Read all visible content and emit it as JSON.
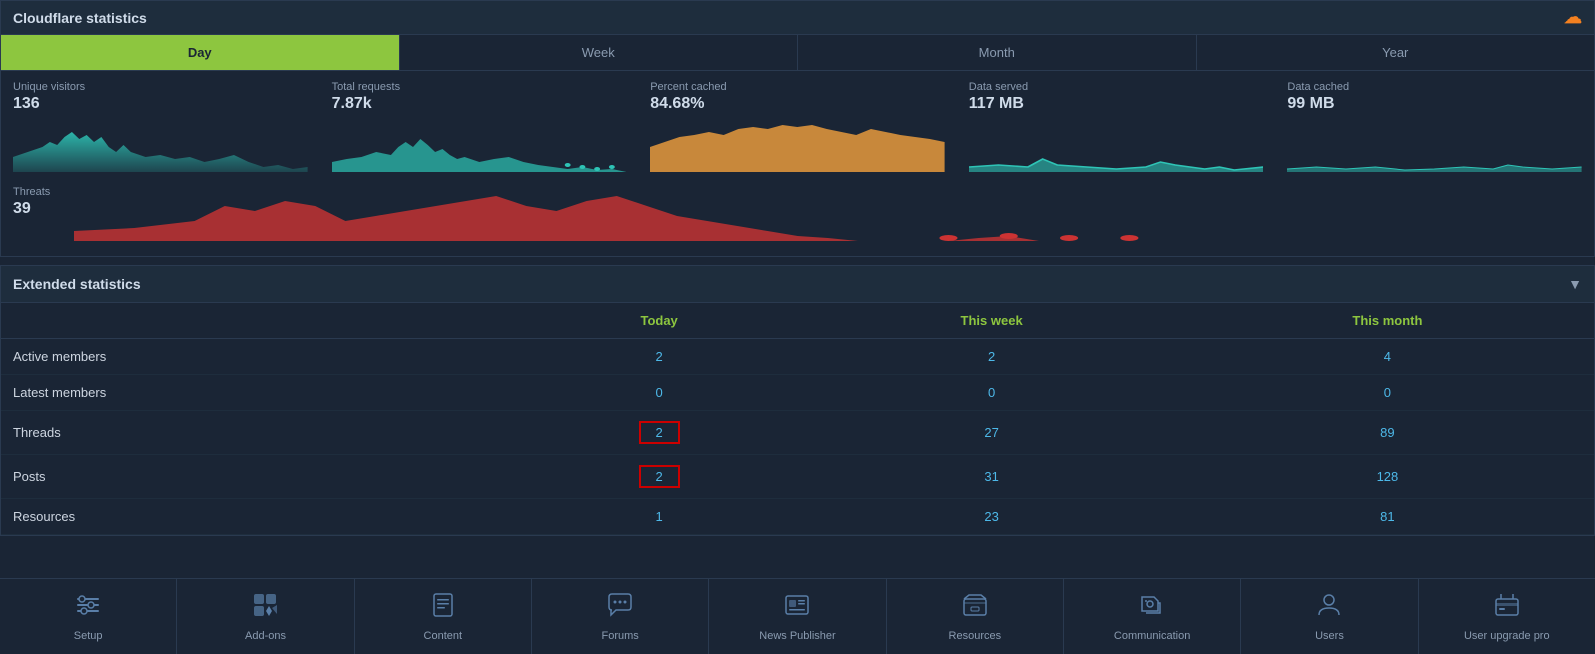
{
  "cloudflare": {
    "title": "Cloudflare statistics",
    "tabs": [
      {
        "label": "Day",
        "active": true
      },
      {
        "label": "Week",
        "active": false
      },
      {
        "label": "Month",
        "active": false
      },
      {
        "label": "Year",
        "active": false
      }
    ],
    "stats": [
      {
        "label": "Unique visitors",
        "value": "136",
        "color": "#2ec4b6"
      },
      {
        "label": "Total requests",
        "value": "7.87k",
        "color": "#2ec4b6"
      },
      {
        "label": "Percent cached",
        "value": "84.68%",
        "color": "#e89a3c"
      },
      {
        "label": "Data served",
        "value": "117 MB",
        "color": "#2ec4b6"
      },
      {
        "label": "Data cached",
        "value": "99 MB",
        "color": "#2ec4b6"
      }
    ],
    "threats": {
      "label": "Threats",
      "value": "39",
      "color": "#cc3333"
    }
  },
  "extended": {
    "title": "Extended statistics",
    "columns": [
      "",
      "Today",
      "This week",
      "This month"
    ],
    "rows": [
      {
        "label": "Active members",
        "today": "2",
        "week": "2",
        "month": "4",
        "highlight_today": false
      },
      {
        "label": "Latest members",
        "today": "0",
        "week": "0",
        "month": "0",
        "highlight_today": false
      },
      {
        "label": "Threads",
        "today": "2",
        "week": "27",
        "month": "89",
        "highlight_today": true
      },
      {
        "label": "Posts",
        "today": "2",
        "week": "31",
        "month": "128",
        "highlight_today": true
      },
      {
        "label": "Resources",
        "today": "1",
        "week": "23",
        "month": "81",
        "highlight_today": false
      }
    ]
  },
  "nav": {
    "items": [
      {
        "label": "Setup",
        "icon": "⚙",
        "symbol": "sliders"
      },
      {
        "label": "Add-ons",
        "icon": "🧩",
        "symbol": "puzzle"
      },
      {
        "label": "Content",
        "icon": "📄",
        "symbol": "content"
      },
      {
        "label": "Forums",
        "icon": "💬",
        "symbol": "forums"
      },
      {
        "label": "News Publisher",
        "icon": "📰",
        "symbol": "news"
      },
      {
        "label": "Resources",
        "icon": "📁",
        "symbol": "resources"
      },
      {
        "label": "Communication",
        "icon": "📢",
        "symbol": "communication"
      },
      {
        "label": "Users",
        "icon": "👤",
        "symbol": "users"
      },
      {
        "label": "User upgrade pro",
        "icon": "🛒",
        "symbol": "upgrade"
      }
    ]
  }
}
